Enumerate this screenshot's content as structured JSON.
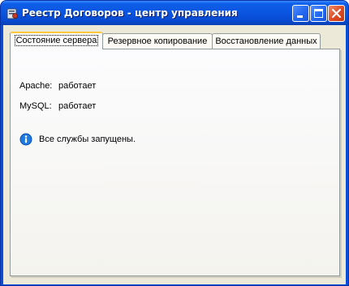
{
  "window": {
    "title": "Реестр Договоров - центр управления"
  },
  "tabs": [
    {
      "label": "Состояние сервера",
      "selected": true
    },
    {
      "label": "Резервное копирование",
      "selected": false
    },
    {
      "label": "Восстановление данных",
      "selected": false
    }
  ],
  "status": {
    "apache": {
      "label": "Apache:",
      "value": "работает"
    },
    "mysql": {
      "label": "MySQL:",
      "value": "работает"
    }
  },
  "info": {
    "icon": "info-icon",
    "message": "Все службы запущены."
  }
}
